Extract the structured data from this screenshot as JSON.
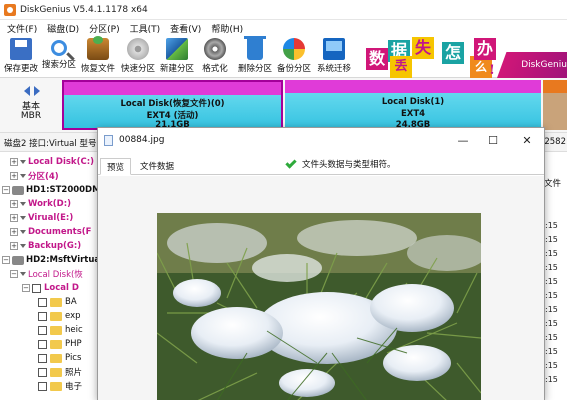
{
  "window": {
    "title": "DiskGenius V5.4.1.1178 x64"
  },
  "menu": [
    "文件(F)",
    "磁盘(D)",
    "分区(P)",
    "工具(T)",
    "查看(V)",
    "帮助(H)"
  ],
  "toolbar": [
    {
      "label": "保存更改",
      "icon": "save-icon"
    },
    {
      "label": "搜索分区",
      "icon": "search-icon"
    },
    {
      "label": "恢复文件",
      "icon": "recover-files-icon"
    },
    {
      "label": "快速分区",
      "icon": "quick-partition-icon"
    },
    {
      "label": "新建分区",
      "icon": "new-partition-icon"
    },
    {
      "label": "格式化",
      "icon": "format-icon"
    },
    {
      "label": "删除分区",
      "icon": "delete-partition-icon"
    },
    {
      "label": "备份分区",
      "icon": "backup-partition-icon"
    },
    {
      "label": "系统迁移",
      "icon": "system-migrate-icon"
    }
  ],
  "banner": {
    "chars": [
      "数",
      "据",
      "丢",
      "失",
      "怎",
      "么",
      "办",
      "!"
    ],
    "brand": "DiskGenius",
    "colors": {
      "pink": "#d01678",
      "teal": "#1aa3a3",
      "yellow": "#f6c500",
      "orange": "#f08a1c"
    }
  },
  "diskmap": {
    "basic": "基本",
    "mbr": "MBR",
    "partitions": [
      {
        "name": "Local Disk(恢复文件)(0)",
        "fs": "EXT4 (活动)",
        "size": "21.1GB"
      },
      {
        "name": "Local Disk(1)",
        "fs": "EXT4",
        "size": "24.8GB"
      }
    ]
  },
  "infoline": {
    "text": "磁盘2 接口:Virtual  型号",
    "right": "2582"
  },
  "tree": [
    {
      "label": "Local Disk(C:)",
      "type": "part"
    },
    {
      "label": "分区(4)",
      "type": "part"
    },
    {
      "label": "HD1:ST2000DM0",
      "type": "disk"
    },
    {
      "label": "Work(D:)",
      "type": "part"
    },
    {
      "label": "Virual(E:)",
      "type": "part"
    },
    {
      "label": "Documents(F",
      "type": "part"
    },
    {
      "label": "Backup(G:)",
      "type": "part"
    },
    {
      "label": "HD2:MsftVirtual",
      "type": "disk"
    },
    {
      "label": "Local Disk(恢",
      "type": "sel"
    },
    {
      "label": "Local D",
      "type": "part"
    },
    {
      "label": "BA",
      "type": "folder"
    },
    {
      "label": "exp",
      "type": "folder"
    },
    {
      "label": "heic",
      "type": "folder"
    },
    {
      "label": "PHP",
      "type": "folder"
    },
    {
      "label": "Pics",
      "type": "folder"
    },
    {
      "label": "照片",
      "type": "folder"
    },
    {
      "label": "电子",
      "type": "folder"
    }
  ],
  "rightcol": {
    "header": "文件",
    "times": [
      ":15",
      ":15",
      ":15",
      ":15",
      ":15",
      ":15",
      ":15",
      ":15",
      ":15",
      ":15",
      ":15",
      ":15"
    ]
  },
  "preview": {
    "filename": "00884.jpg",
    "tabs": [
      "预览",
      "文件数据"
    ],
    "status": "文件头数据与类型相符。",
    "buttons": {
      "minimize": "—",
      "maximize": "☐",
      "close": "✕"
    }
  }
}
